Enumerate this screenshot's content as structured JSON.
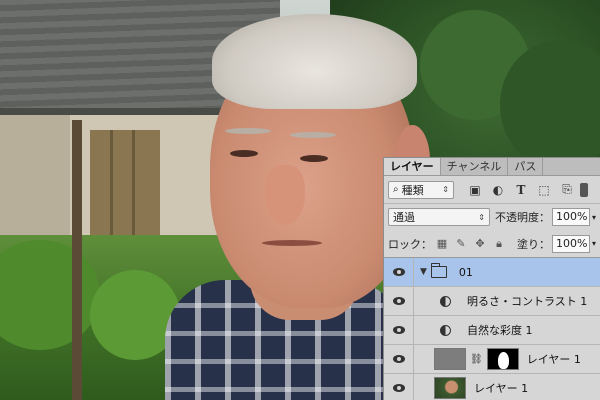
{
  "tabs": [
    "レイヤー",
    "チャンネル",
    "パス"
  ],
  "filter": {
    "label": "種類",
    "icons": [
      "image-filter-icon",
      "adjustment-filter-icon",
      "type-filter-icon",
      "shape-filter-icon",
      "smart-object-filter-icon"
    ]
  },
  "blend": {
    "mode": "通過",
    "opacity_label": "不透明度：",
    "opacity_value": "100%"
  },
  "lock": {
    "label": "ロック：",
    "fill_label": "塗り：",
    "fill_value": "100%"
  },
  "layers": [
    {
      "name": "01",
      "type": "group",
      "selected": true
    },
    {
      "name": "明るさ・コントラスト 1",
      "type": "adjustment"
    },
    {
      "name": "自然な彩度 1",
      "type": "adjustment"
    },
    {
      "name": "レイヤー 1",
      "type": "masked-layer"
    },
    {
      "name": "レイヤー 1",
      "type": "pixel-layer"
    }
  ]
}
